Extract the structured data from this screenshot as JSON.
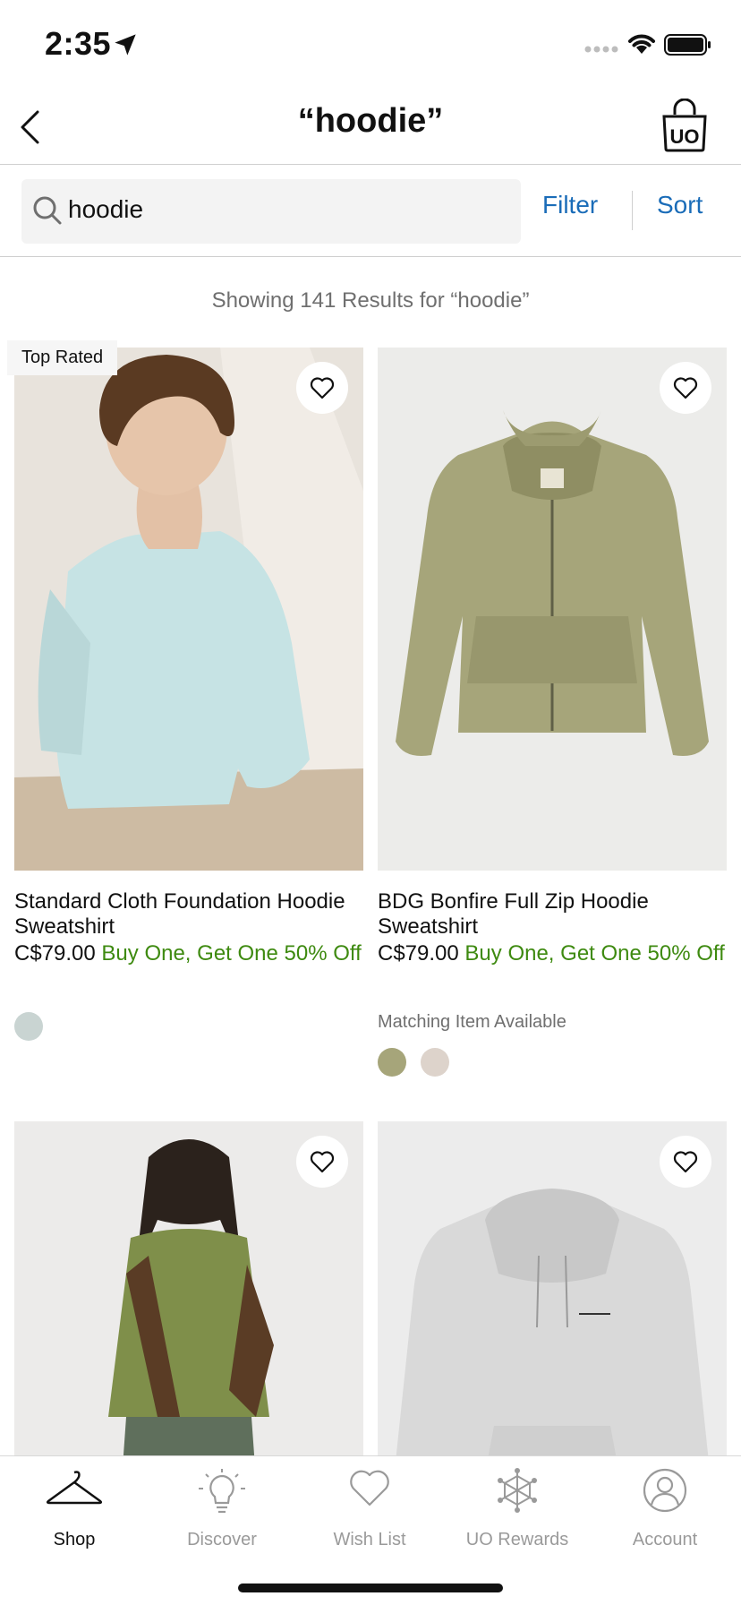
{
  "status_bar": {
    "time": "2:35"
  },
  "header": {
    "title": "“hoodie”"
  },
  "search": {
    "query": "hoodie",
    "filter_label": "Filter",
    "sort_label": "Sort"
  },
  "results": {
    "summary": "Showing 141 Results for “hoodie”"
  },
  "products": [
    {
      "badge": "Top Rated",
      "name": "Standard Cloth Foundation Hoodie Sweatshirt",
      "price": "C$79.00",
      "promo": "Buy One, Get One 50% Off",
      "swatches": [
        "#c9d4d2"
      ]
    },
    {
      "name": "BDG Bonfire Full Zip Hoodie Sweatshirt",
      "price": "C$79.00",
      "promo": "Buy One, Get One 50% Off",
      "note": "Matching Item Available",
      "swatches": [
        "#a6a57a",
        "#ddd3cb"
      ]
    },
    {
      "swatches": []
    },
    {
      "swatches": []
    }
  ],
  "tab_bar": {
    "items": [
      {
        "label": "Shop",
        "icon": "hanger-icon",
        "active": true
      },
      {
        "label": "Discover",
        "icon": "lightbulb-icon",
        "active": false
      },
      {
        "label": "Wish List",
        "icon": "heart-icon",
        "active": false
      },
      {
        "label": "UO Rewards",
        "icon": "rewards-icon",
        "active": false
      },
      {
        "label": "Account",
        "icon": "person-icon",
        "active": false
      }
    ]
  },
  "colors": {
    "link": "#1a6cb8",
    "promo": "#3e8a10",
    "muted": "#6f6f6f"
  }
}
